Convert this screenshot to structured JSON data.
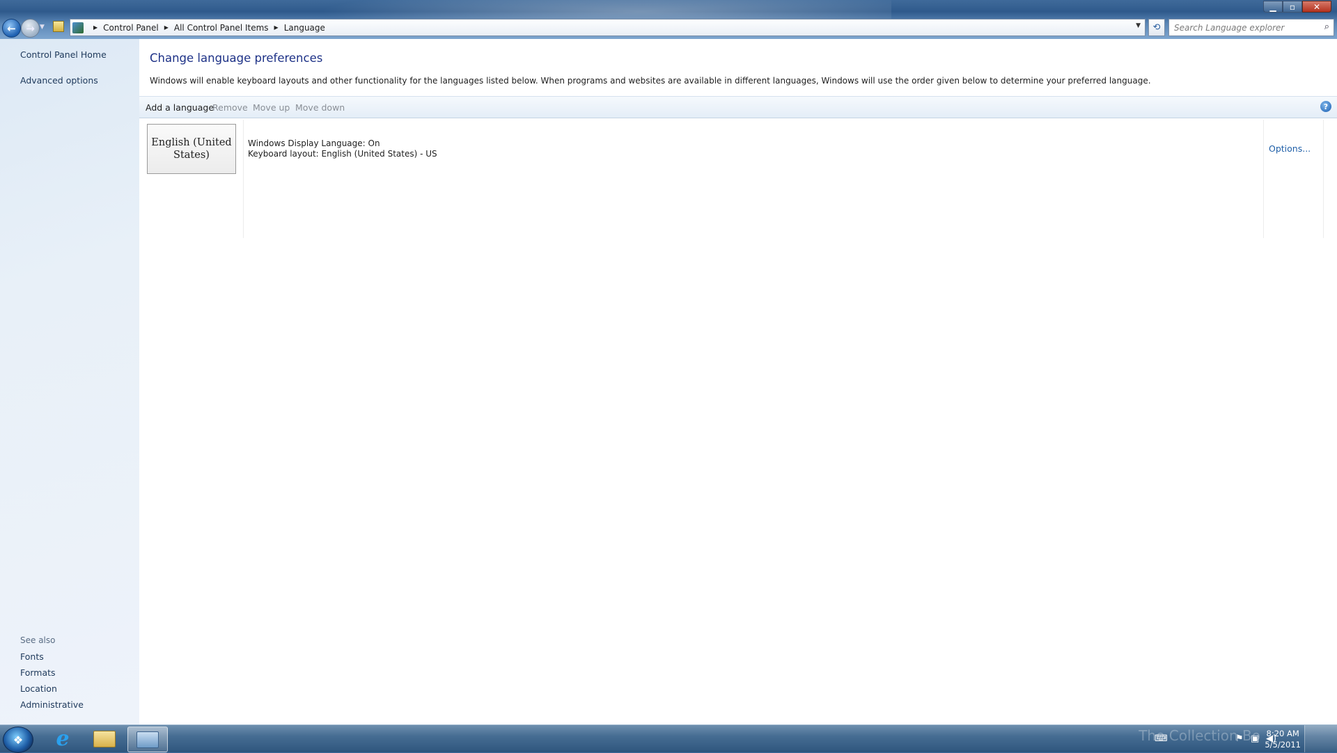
{
  "window": {
    "controls": {
      "minimize_icon": "minimize-icon",
      "maximize_icon": "maximize-icon",
      "close_icon": "close-icon"
    }
  },
  "address_bar": {
    "breadcrumbs": [
      "Control Panel",
      "All Control Panel Items",
      "Language"
    ]
  },
  "search": {
    "placeholder": "Search Language explorer"
  },
  "sidebar": {
    "top_links": [
      "Control Panel Home",
      "Advanced options"
    ],
    "see_also_label": "See also",
    "see_also_links": [
      "Fonts",
      "Formats",
      "Location",
      "Administrative"
    ]
  },
  "main": {
    "title": "Change language preferences",
    "description": "Windows will enable keyboard layouts and other functionality for the languages listed below. When programs and websites are available in different languages, Windows will use the order given below to determine your preferred language.",
    "toolbar": {
      "add": "Add a language",
      "remove": "Remove",
      "move_up": "Move up",
      "move_down": "Move down"
    },
    "languages": [
      {
        "tile_line1": "English (United",
        "tile_line2": "States)",
        "display_language": "Windows Display Language: On",
        "keyboard_layout": "Keyboard layout: English (United States) - US",
        "options_label": "Options..."
      }
    ]
  },
  "taskbar": {
    "clock_time": "8:20 AM",
    "clock_date": "5/5/2011",
    "watermark": "The Collection Bo"
  },
  "colors": {
    "link": "#1f5fa8",
    "heading": "#1e3287",
    "disabled_text": "#8a8f96",
    "sidebar_bg": "#e8f0f8"
  }
}
